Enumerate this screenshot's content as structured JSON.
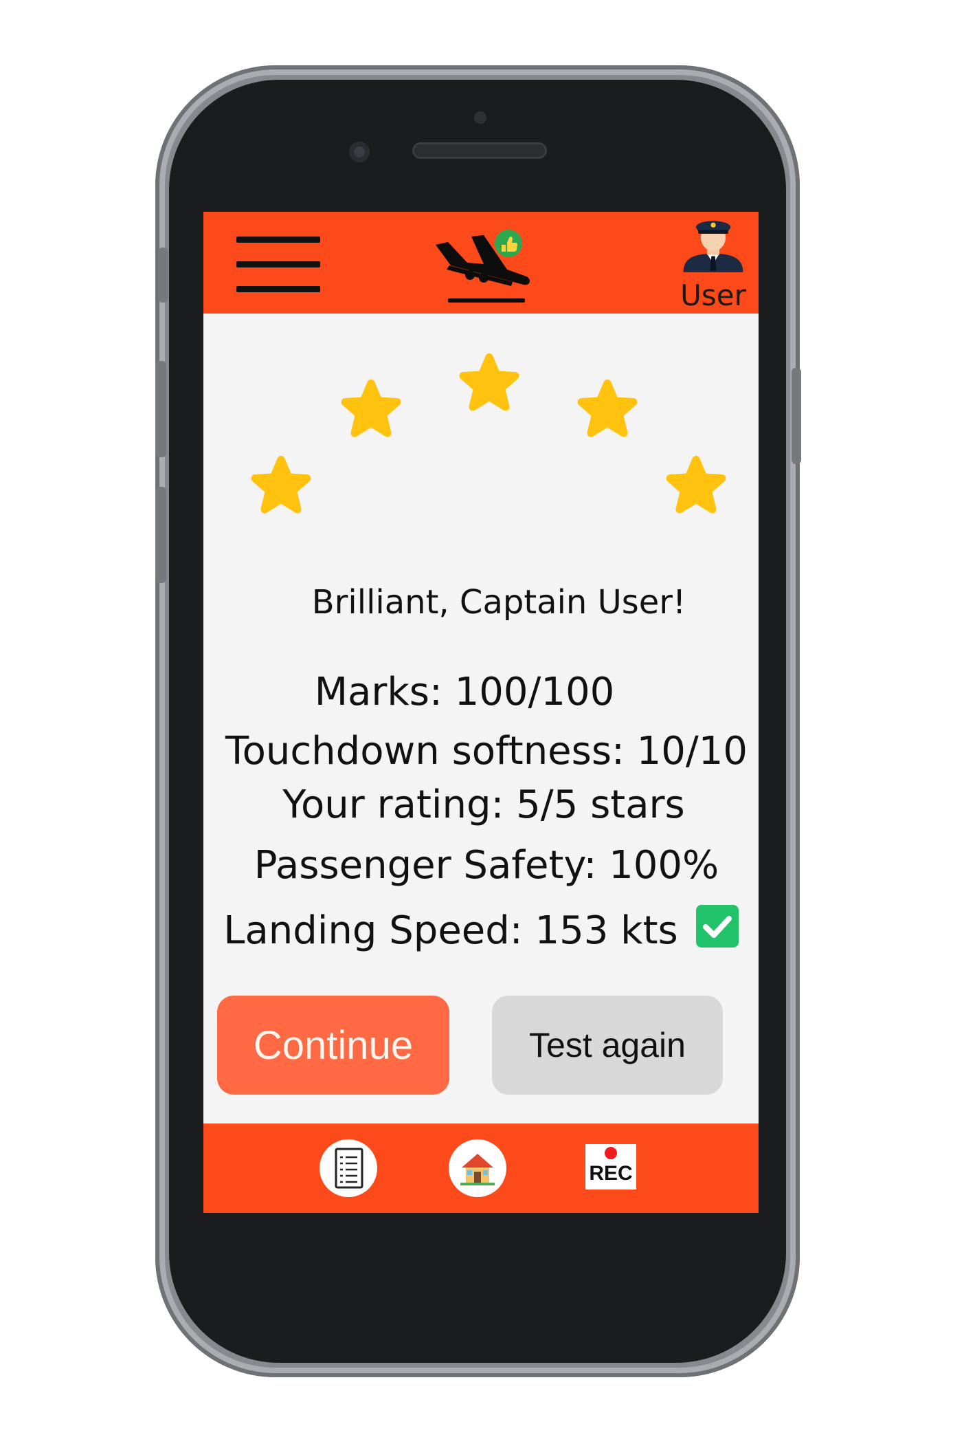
{
  "header": {
    "menu_icon": "hamburger-menu-icon",
    "logo_icon": "airplane-landing-thumbs-up-icon",
    "user_label": "User",
    "user_icon": "pilot-avatar-icon"
  },
  "rating": {
    "stars_filled": 5,
    "stars_total": 5,
    "star_color": "#ffc20e"
  },
  "result": {
    "greeting": "Brilliant, Captain User!",
    "marks": "Marks: 100/100",
    "touchdown": "Touchdown softness: 10/10",
    "your_rating": "Your rating: 5/5 stars",
    "safety": "Passenger Safety: 100%",
    "speed": "Landing Speed: 153 kts",
    "speed_status_icon": "green-check-icon"
  },
  "actions": {
    "continue_label": "Continue",
    "test_again_label": "Test again"
  },
  "bottom_nav": {
    "items": [
      {
        "icon": "checklist-icon"
      },
      {
        "icon": "home-icon"
      },
      {
        "icon": "record-icon",
        "label": "REC"
      }
    ]
  },
  "colors": {
    "accent": "#fc4a1a",
    "continue": "#ff6a45",
    "secondary": "#d8d8d8",
    "check": "#21c36a"
  }
}
